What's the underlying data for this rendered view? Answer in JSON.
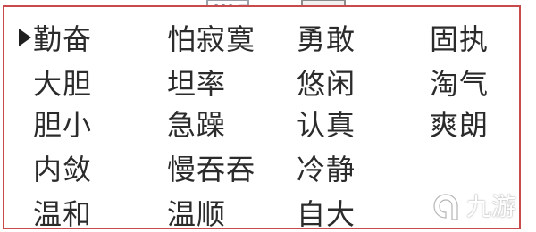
{
  "grid": {
    "rows": [
      [
        "勤奋",
        "怕寂寞",
        "勇敢",
        "固执"
      ],
      [
        "大胆",
        "坦率",
        "悠闲",
        "淘气"
      ],
      [
        "胆小",
        "急躁",
        "认真",
        "爽朗"
      ],
      [
        "内敛",
        "慢吞吞",
        "冷静",
        ""
      ],
      [
        "温和",
        "温顺",
        "自大",
        ""
      ]
    ]
  },
  "cursor_icon": "triangle-right-icon",
  "watermark": {
    "text": "九游",
    "icon": "nine-game-logo-icon",
    "color": "#ffffff"
  },
  "colors": {
    "frame": "#c84a4a",
    "text": "#2b2b2b",
    "background": "#ffffff"
  }
}
